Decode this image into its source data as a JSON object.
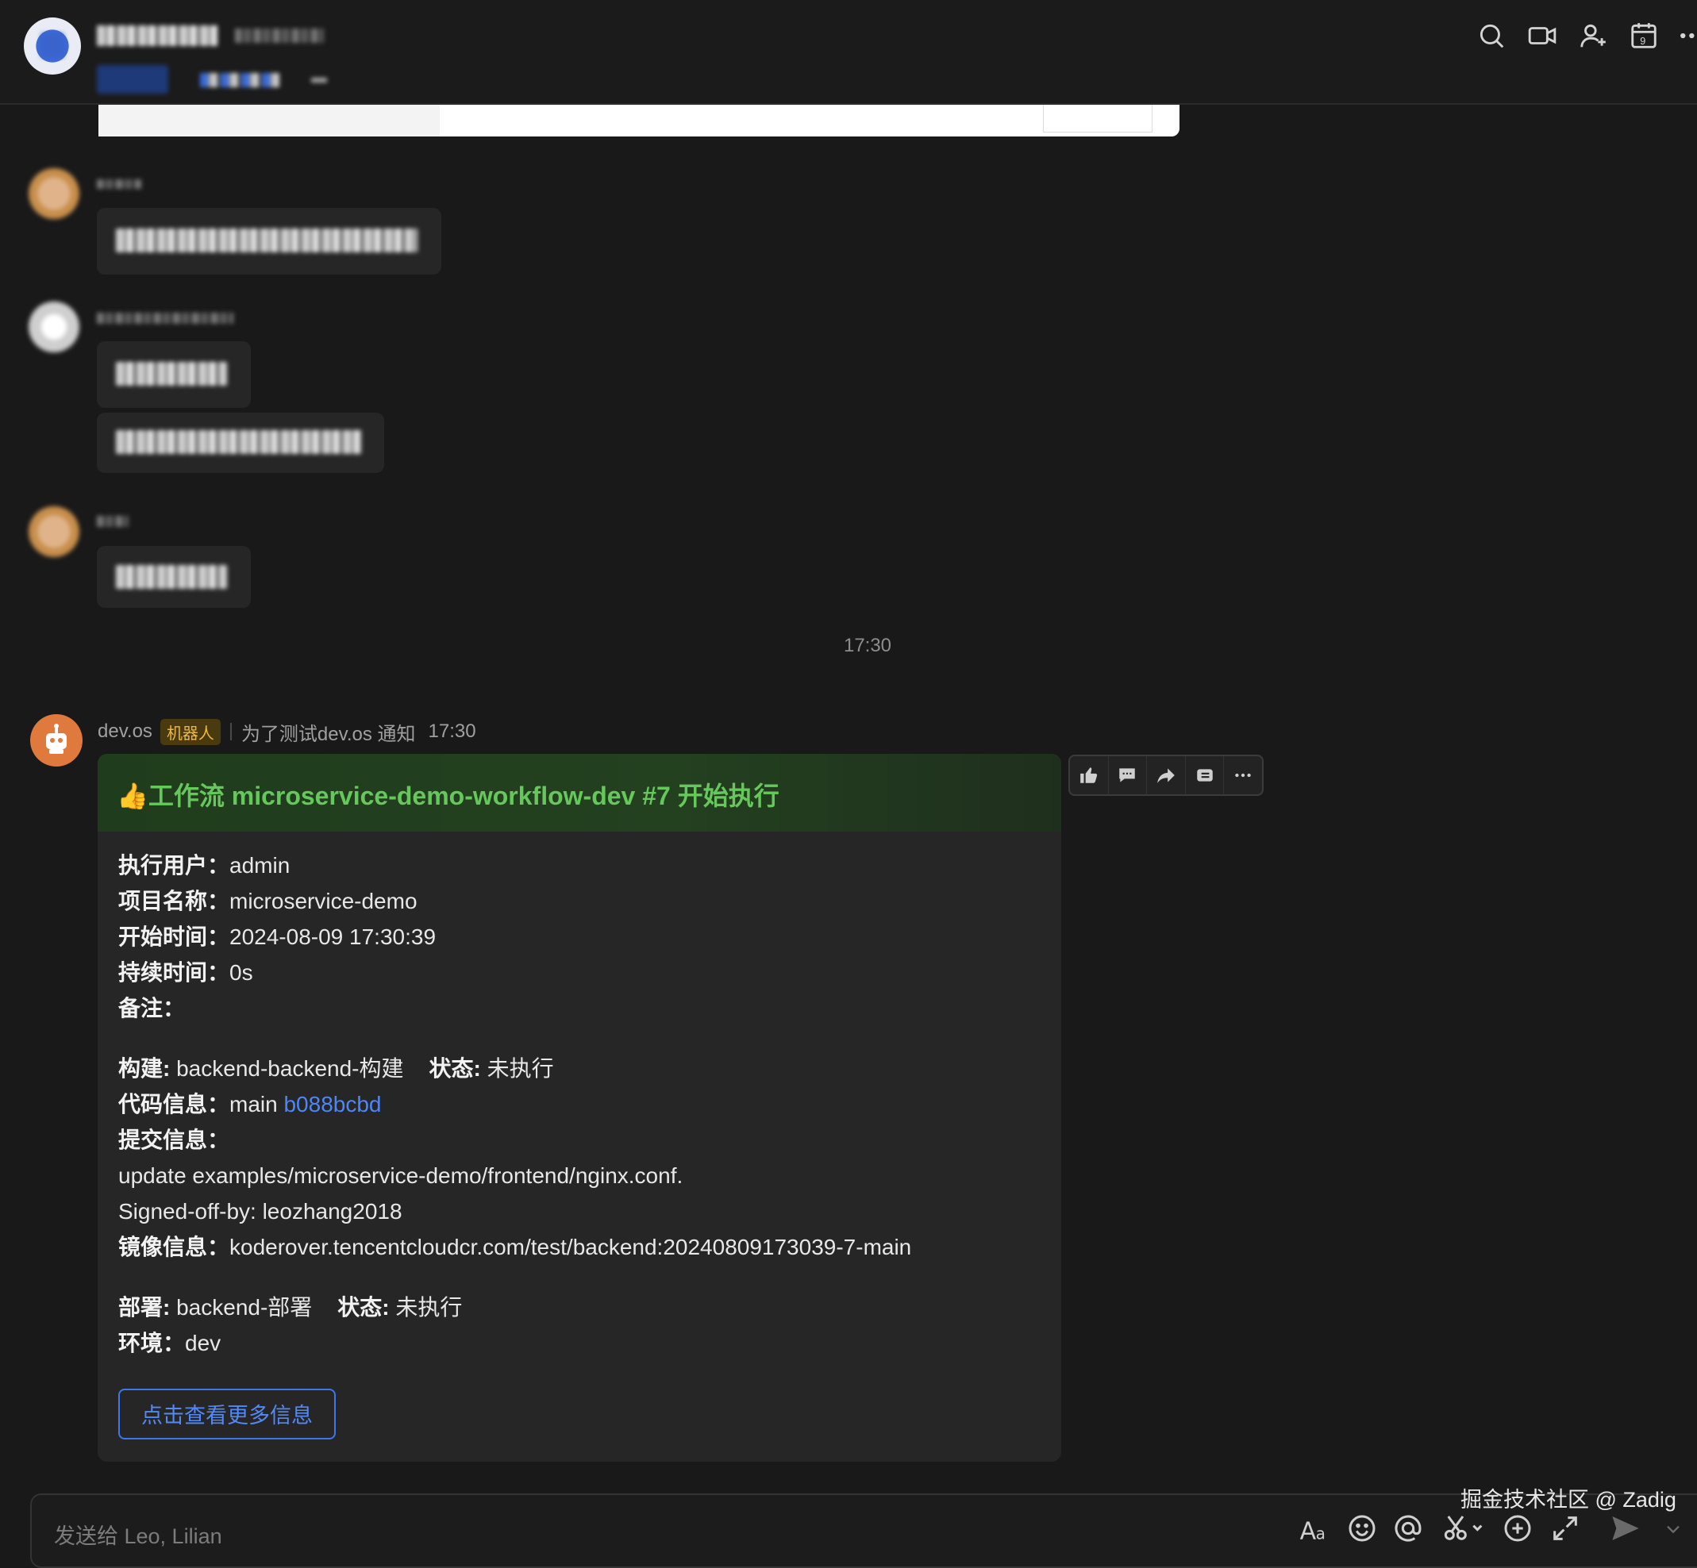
{
  "timestamp_divider": "17:30",
  "bot_message": {
    "sender": "dev.os",
    "badge": "机器人",
    "source": "为了测试dev.os 通知",
    "time": "17:30",
    "title": "👍工作流 microservice-demo-workflow-dev #7 开始执行",
    "fields": {
      "user_label": "执行用户：",
      "user_value": "admin",
      "project_label": "项目名称：",
      "project_value": "microservice-demo",
      "start_label": "开始时间：",
      "start_value": "2024-08-09 17:30:39",
      "duration_label": "持续时间：",
      "duration_value": "0s",
      "remark_label": "备注："
    },
    "build": {
      "label": "构建:",
      "value": " backend-backend-构建",
      "status_label": "状态:",
      "status_value": " 未执行",
      "code_label": "代码信息：",
      "code_branch": "main ",
      "code_commit": "b088bcbd",
      "commit_label": "提交信息：",
      "commit_line1": "update examples/microservice-demo/frontend/nginx.conf.",
      "commit_line2": "Signed-off-by: leozhang2018",
      "image_label": "镜像信息：",
      "image_value": "koderover.tencentcloudcr.com/test/backend:20240809173039-7-main"
    },
    "deploy": {
      "label": "部署:",
      "value": " backend-部署",
      "status_label": "状态:",
      "status_value": " 未执行",
      "env_label": "环境：",
      "env_value": "dev"
    },
    "more_button": "点击查看更多信息"
  },
  "composer": {
    "placeholder": "发送给 Leo, Lilian"
  },
  "watermark": "掘金技术社区 @ Zadig",
  "colors": {
    "background": "#191919",
    "card": "#262626",
    "title_green": "#66c85c",
    "link_blue": "#4f86f7",
    "badge_text": "#f0b73c"
  },
  "icons": {
    "header": [
      "search-icon",
      "video-call-icon",
      "add-member-icon",
      "calendar-icon",
      "more-icon"
    ],
    "actions": [
      "thumbs-up-icon",
      "reply-icon",
      "forward-icon",
      "pin-icon",
      "more-icon"
    ],
    "toolbar": [
      "text-format-icon",
      "emoji-icon",
      "mention-icon",
      "scissors-icon",
      "add-icon",
      "expand-icon",
      "send-icon"
    ]
  }
}
